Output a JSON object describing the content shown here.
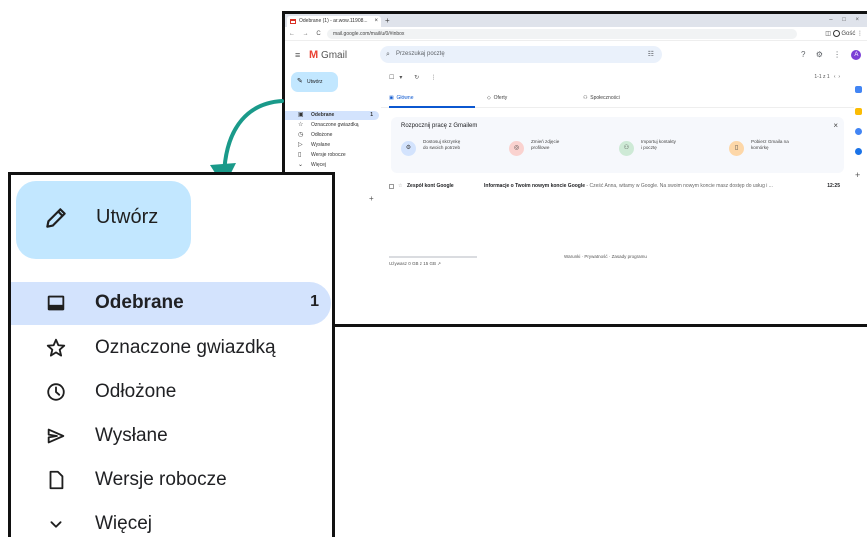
{
  "window": {
    "tab_title": "Odebrane (1) - ar.wow.11908...",
    "tab_close": "×",
    "new_tab": "+",
    "window_controls": "–  □  ×",
    "nav_buttons": "←  →  C",
    "url": "mail.google.com/mail/u/0/#inbox",
    "profile_label": "Gość"
  },
  "gmail_header": {
    "brand": "Gmail",
    "search_placeholder": "Przeszukaj pocztę",
    "avatar_letter": "A"
  },
  "small_sidebar": {
    "compose_label": "Utwórz",
    "items": [
      {
        "label": "Odebrane",
        "count": "1",
        "icon": "inbox-icon"
      },
      {
        "label": "Oznaczone gwiazdką",
        "icon": "star-icon"
      },
      {
        "label": "Odłożone",
        "icon": "clock-icon"
      },
      {
        "label": "Wysłane",
        "icon": "send-icon"
      },
      {
        "label": "Wersje robocze",
        "icon": "file-icon"
      },
      {
        "label": "Więcej",
        "icon": "chevron-down-icon"
      }
    ],
    "labels_add": "+"
  },
  "small_main": {
    "pager": "1-1 z 1",
    "tabs": [
      {
        "label": "Główne"
      },
      {
        "label": "Oferty"
      },
      {
        "label": "Społeczności"
      }
    ],
    "card": {
      "title": "Rozpocznij pracę z Gmailem",
      "features": [
        {
          "line1": "Dostosuj skrzynkę",
          "line2": "do swoich potrzeb",
          "color": "#d3e3fd"
        },
        {
          "line1": "Zmień zdjęcie",
          "line2": "profilowe",
          "color": "#fad2cf"
        },
        {
          "line1": "Importuj kontakty",
          "line2": "i pocztę",
          "color": "#ceead6"
        },
        {
          "line1": "Pobierz Gmaila na",
          "line2": "komórkę",
          "color": "#fdd7a8"
        }
      ]
    },
    "email": {
      "sender": "Zespół kont Google",
      "subject": "Informacje o Twoim nowym koncie Google",
      "snippet": " - Cześć Anna, witamy w Google. Na swoim nowym koncie masz dostęp do usług i ...",
      "time": "12:25"
    },
    "storage": "Używasz 0 GB z 15 GB",
    "footer_links": "Warunki · Prywatność · Zasady programu"
  },
  "zoom_sidebar": {
    "compose_label": "Utwórz",
    "items": [
      {
        "label": "Odebrane",
        "count": "1",
        "icon": "inbox-icon"
      },
      {
        "label": "Oznaczone gwiazdką",
        "icon": "star-icon"
      },
      {
        "label": "Odłożone",
        "icon": "clock-icon"
      },
      {
        "label": "Wysłane",
        "icon": "send-icon"
      },
      {
        "label": "Wersje robocze",
        "icon": "file-icon"
      },
      {
        "label": "Więcej",
        "icon": "chevron-down-icon"
      }
    ]
  },
  "colors": {
    "arrow": "#1a9a8a",
    "compose_bg": "#c2e7ff",
    "active_bg": "#d3e3fd"
  }
}
